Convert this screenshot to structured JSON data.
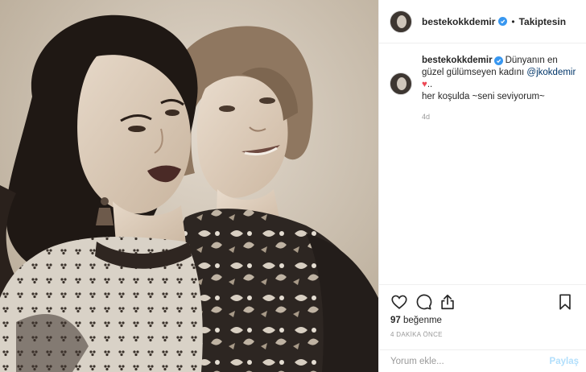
{
  "header": {
    "username": "bestekokkdemir",
    "separator": "•",
    "follow_label": "Takiptesin"
  },
  "caption": {
    "username": "bestekokkdemir",
    "text_before": "Dünyanın en güzel gülümseyen kadını ",
    "mention": "@jkokdemir",
    "heart": "♥",
    "text_after": "..",
    "line2": "her koşulda ~seni seviyorum~",
    "time": "4d"
  },
  "actions": {
    "like_icon": "heart-outline-icon",
    "comment_icon": "comment-icon",
    "share_icon": "share-icon",
    "save_icon": "bookmark-icon"
  },
  "likes": {
    "count": "97",
    "label": "beğenme"
  },
  "post_time": "4 DAKİKA ÖNCE",
  "comment": {
    "placeholder": "Yorum ekle...",
    "post_label": "Paylaş"
  },
  "colors": {
    "verified": "#3897f0",
    "mention": "#003569",
    "heart": "#ed4956",
    "post_disabled": "#b2dffc",
    "muted": "#999999"
  }
}
